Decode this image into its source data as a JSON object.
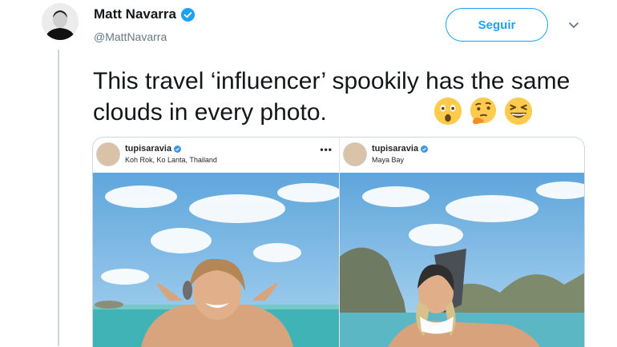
{
  "tweet": {
    "author_name": "Matt Navarra",
    "author_handle": "@MattNavarra",
    "follow_label": "Seguir",
    "text": "This travel ‘influencer’ spookily has the same clouds in every photo.",
    "emoji_icons": [
      "astonished-face-icon",
      "thinking-face-icon",
      "squinting-laughing-face-icon"
    ]
  },
  "media": {
    "posts": [
      {
        "username": "tupisaravia",
        "location": "Koh Rok, Ko Lanta, Thailand",
        "menu": "•••"
      },
      {
        "username": "tupisaravia",
        "location": "Maya Bay"
      }
    ]
  },
  "colors": {
    "accent": "#1da1f2",
    "text": "#14171a",
    "secondary": "#657786",
    "sky": "#7ab8e6",
    "sea": "#3fb3b6"
  }
}
